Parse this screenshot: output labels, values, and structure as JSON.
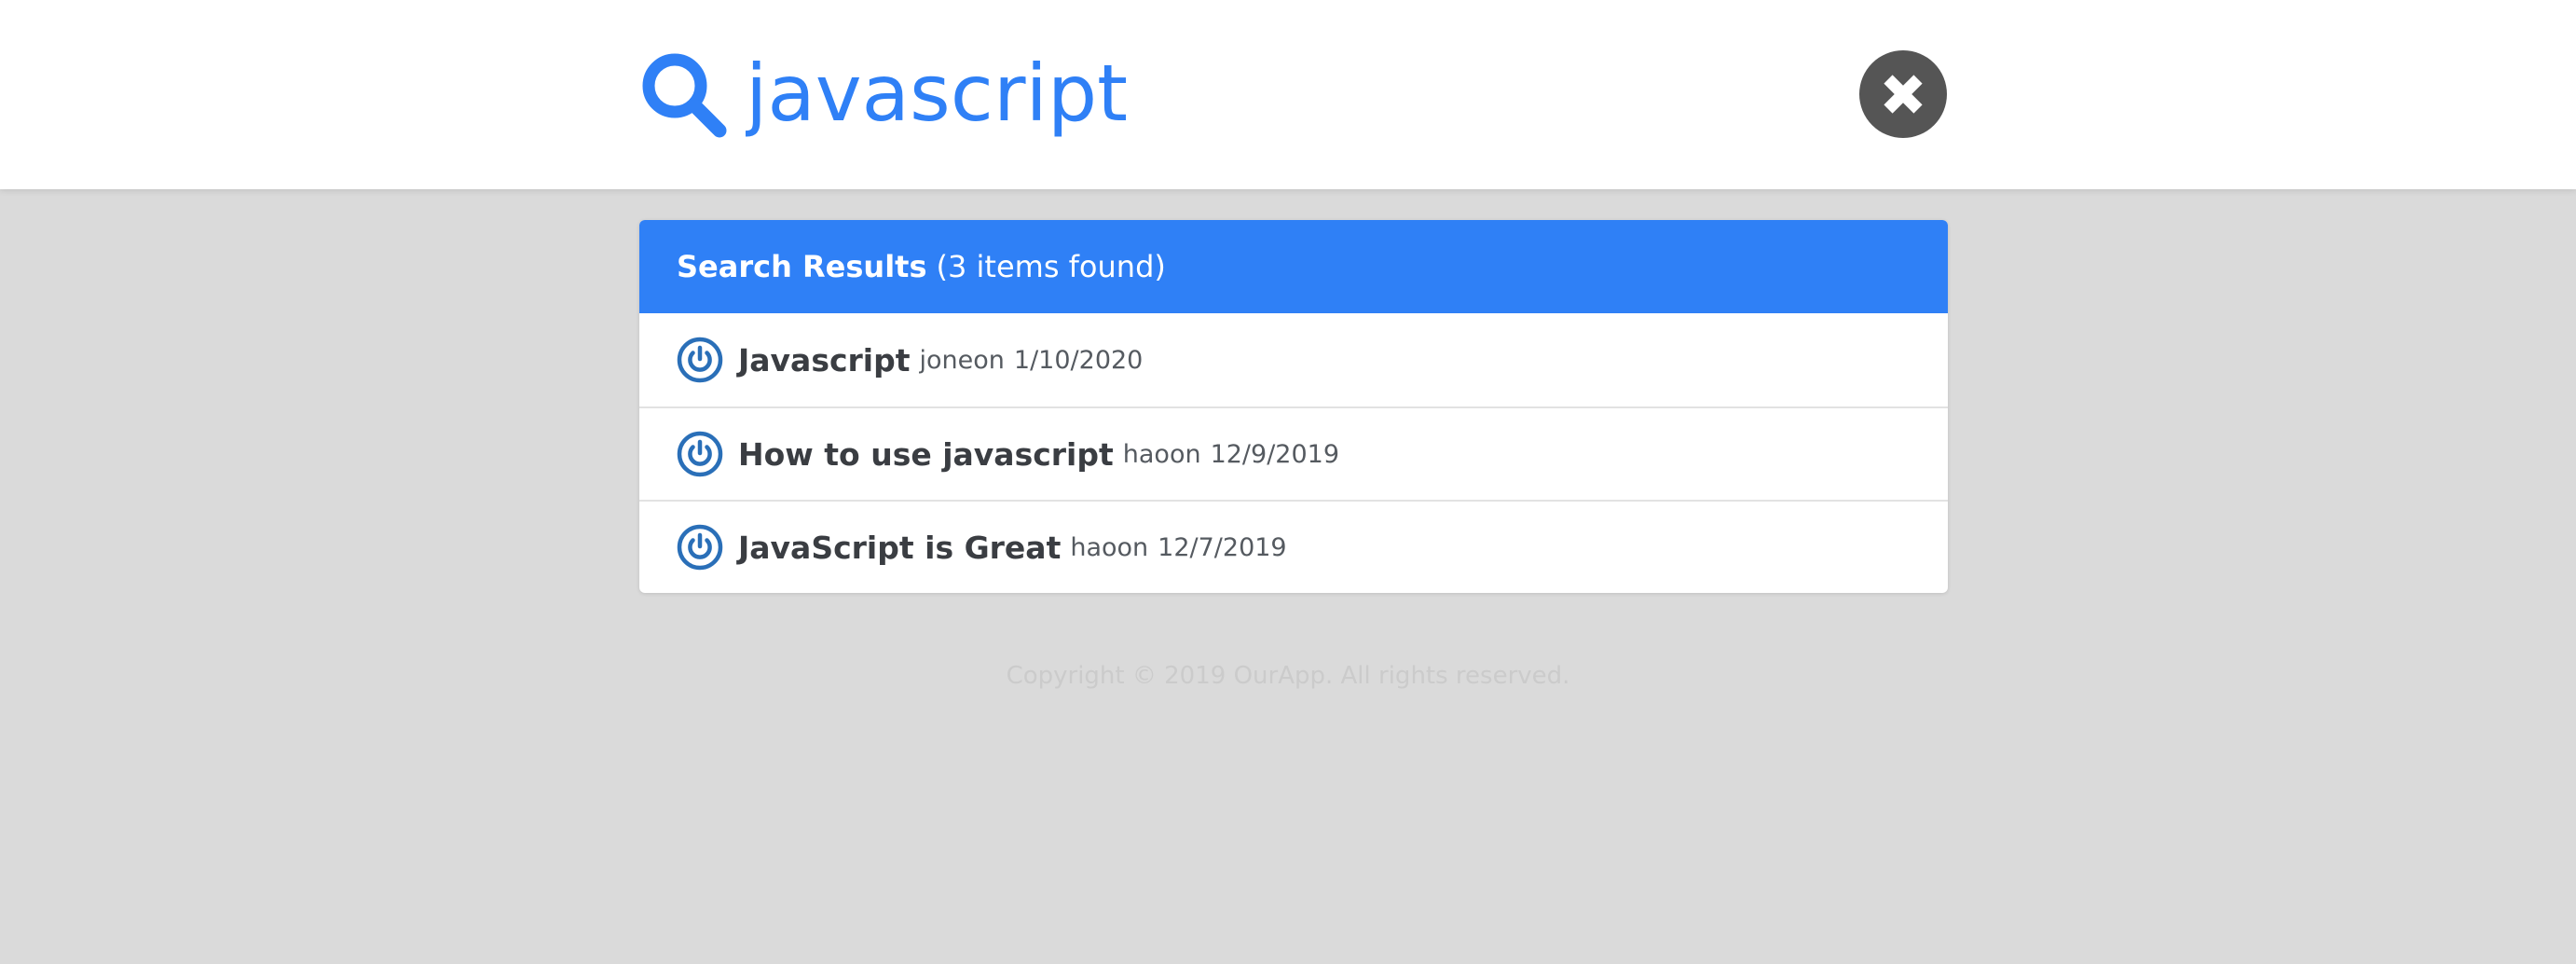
{
  "search": {
    "query": "javascript"
  },
  "results": {
    "title": "Search Results",
    "count_text": "(3 items found)",
    "items": [
      {
        "title": "Javascript",
        "author": "joneon",
        "date": "1/10/2020"
      },
      {
        "title": "How to use javascript",
        "author": "haoon",
        "date": "12/9/2019"
      },
      {
        "title": "JavaScript is Great",
        "author": "haoon",
        "date": "12/7/2019"
      }
    ]
  },
  "footer": {
    "text": "Copyright © 2019 OurApp. All rights reserved."
  },
  "colors": {
    "accent": "#2f80f6",
    "close_button": "#555555",
    "overlay_background": "#dadada",
    "avatar": "#2a6fb8"
  },
  "icons": {
    "search": "search-icon",
    "close": "close-icon",
    "avatar": "power-icon"
  }
}
